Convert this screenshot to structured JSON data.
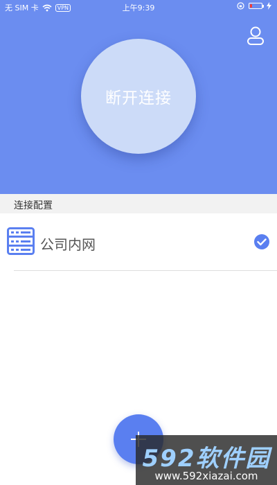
{
  "status_bar": {
    "carrier": "无 SIM 卡",
    "vpn_badge": "VPN",
    "time": "上午9:39",
    "battery_level": 0.18,
    "battery_color": "#ff3b30"
  },
  "header": {
    "background_color": "#6b8df0",
    "connect_button_label": "断开连接",
    "profile_icon": "user-icon"
  },
  "config_section": {
    "title": "连接配置",
    "items": [
      {
        "name": "公司内网",
        "icon": "server-icon",
        "selected": true
      }
    ]
  },
  "fab": {
    "icon": "plus-icon",
    "color": "#5a7ff0"
  },
  "watermark": {
    "brand": "592软件园",
    "url": "www.592xiazai.com"
  }
}
